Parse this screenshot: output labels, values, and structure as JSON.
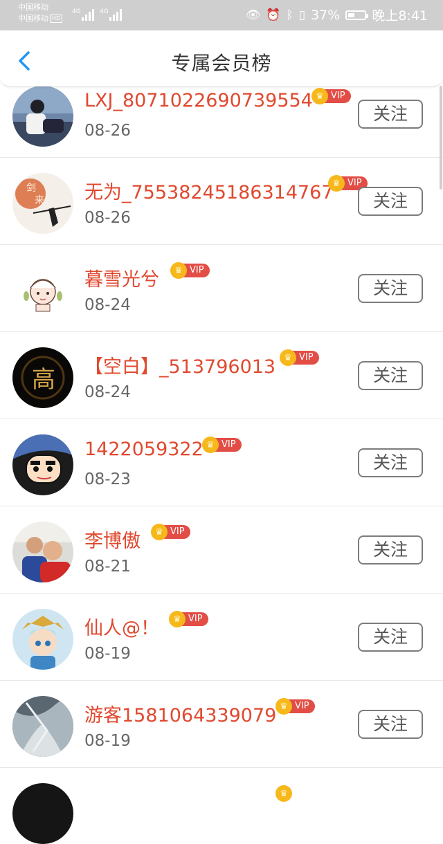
{
  "status_bar": {
    "carrier1": "中国移动",
    "carrier2": "中国移动",
    "hd": "HD",
    "net1": "4G",
    "net2": "4G",
    "battery": "37%",
    "time": "晚上8:41"
  },
  "header": {
    "title": "专属会员榜",
    "back_icon": "chevron-left-icon"
  },
  "colors": {
    "username": "#e0492f",
    "vip_badge": "#e24d46",
    "crown": "#f6b81a",
    "back_icon": "#2196f3"
  },
  "vip_label": "VIP",
  "follow_label": "关注",
  "members": [
    {
      "name": "LXJ_8071022690739554",
      "date": "08-26"
    },
    {
      "name": "无为_75538245186314767",
      "date": "08-26"
    },
    {
      "name": "暮雪光兮",
      "date": "08-24"
    },
    {
      "name": "【空白】_513796013",
      "date": "08-24"
    },
    {
      "name": "1422059322",
      "date": "08-23"
    },
    {
      "name": "李博傲",
      "date": "08-21"
    },
    {
      "name": "仙人@！",
      "date": "08-19"
    },
    {
      "name": "游客1581064339079",
      "date": "08-19"
    }
  ]
}
